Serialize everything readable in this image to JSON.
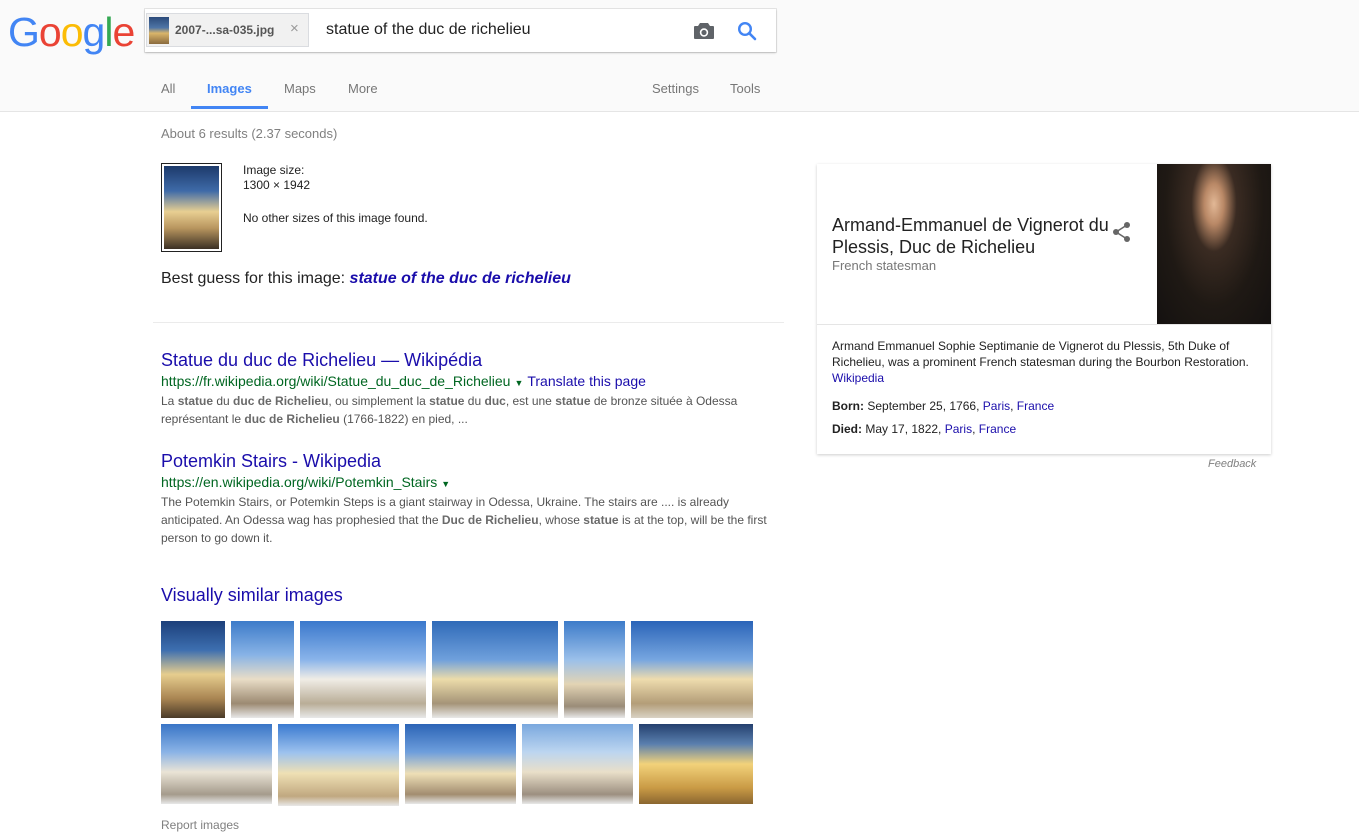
{
  "header": {
    "logo_text": "Google",
    "image_chip": {
      "filename": "2007-...sa-035.jpg",
      "close_glyph": "×"
    },
    "query": "statue of the duc de richelieu",
    "icons": [
      "camera-icon",
      "search-icon"
    ]
  },
  "tabs": [
    {
      "label": "All"
    },
    {
      "label": "Images",
      "active": true
    },
    {
      "label": "Maps"
    },
    {
      "label": "More"
    },
    {
      "label": "Settings"
    },
    {
      "label": "Tools"
    }
  ],
  "stats": "About 6 results (2.37 seconds)",
  "image_info": {
    "size_label": "Image size:",
    "size_value": "1300 × 1942",
    "no_sizes": "No other sizes of this image found.",
    "best_guess_label": "Best guess for this image:",
    "best_guess_query": "statue of the duc de richelieu"
  },
  "results": [
    {
      "title": "Statue du duc de Richelieu — Wikipédia",
      "url": "https://fr.wikipedia.org/wiki/Statue_du_duc_de_Richelieu",
      "translate": "Translate this page",
      "snippet_html": "La <b>statue</b> du <b>duc de Richelieu</b>, ou simplement la <b>statue</b> du <b>duc</b>, est une <b>statue</b> de bronze située à Odessa représentant le <b>duc de Richelieu</b> (1766-1822) en pied, ..."
    },
    {
      "title": "Potemkin Stairs - Wikipedia",
      "url": "https://en.wikipedia.org/wiki/Potemkin_Stairs",
      "translate": "",
      "snippet_html": "The Potemkin Stairs, or Potemkin Steps is a giant stairway in Odessa, Ukraine. The stairs are .... is already anticipated. An Odessa wag has prophesied that the <b>Duc de Richelieu</b>, whose <b>statue</b> is at the top, will be the first person to go down it."
    }
  ],
  "similar": {
    "title": "Visually similar images",
    "report": "Report images"
  },
  "knowledge_panel": {
    "name": "Armand-Emmanuel de Vignerot du Plessis, Duc de Richelieu",
    "subtitle": "French statesman",
    "description": "Armand Emmanuel Sophie Septimanie de Vignerot du Plessis, 5th Duke of Richelieu, was a prominent French statesman during the Bourbon Restoration.",
    "source": "Wikipedia",
    "born_label": "Born:",
    "born_date": "September 25, 1766,",
    "born_city": "Paris",
    "born_country": "France",
    "died_label": "Died:",
    "died_date": "May 17, 1822,",
    "died_city": "Paris",
    "died_country": "France",
    "feedback": "Feedback"
  },
  "colors": {
    "link": "#1a0dab",
    "url_green": "#006621",
    "accent_blue": "#4285f4"
  }
}
